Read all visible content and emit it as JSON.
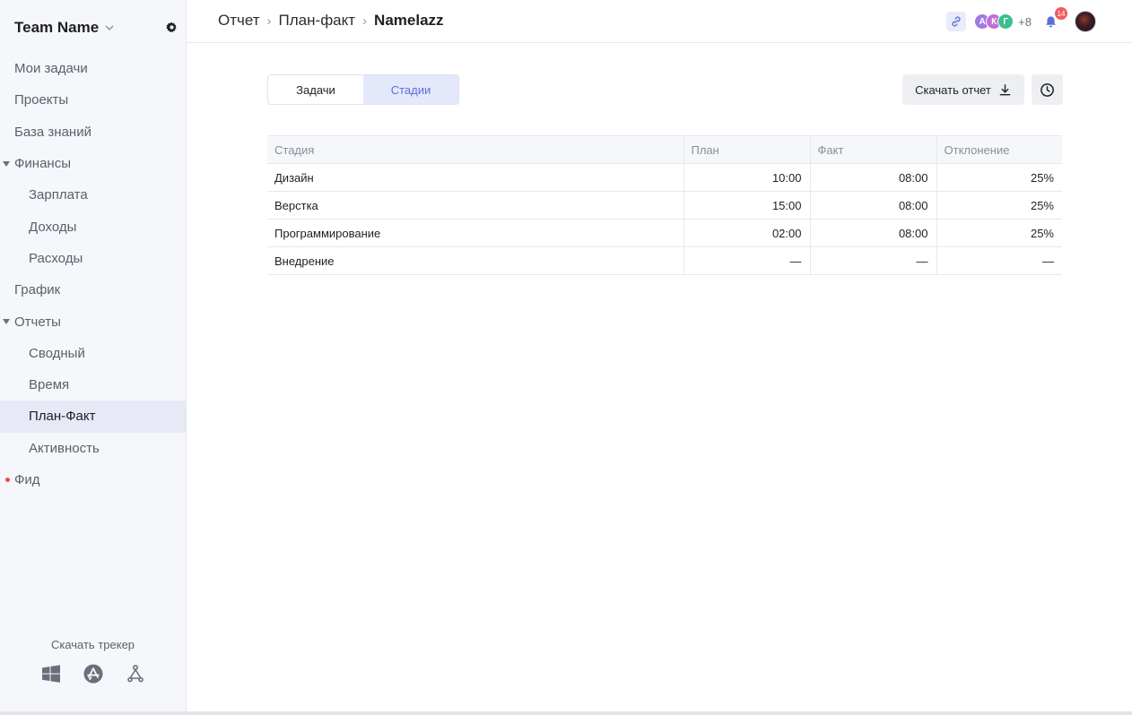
{
  "team": {
    "name": "Team Name"
  },
  "nav": {
    "my_tasks": "Мои задачи",
    "projects": "Проекты",
    "knowledge": "База знаний",
    "finance": "Финансы",
    "salary": "Зарплата",
    "income": "Доходы",
    "expenses": "Расходы",
    "schedule": "График",
    "reports": "Отчеты",
    "summary": "Сводный",
    "time": "Время",
    "plan_fact": "План-Факт",
    "activity": "Активность",
    "feed": "Фид"
  },
  "tracker": {
    "label": "Скачать трекер",
    "icons": [
      "windows-icon",
      "app-store-icon",
      "linux-icon"
    ]
  },
  "breadcrumbs": {
    "root": "Отчет",
    "section": "План-факт",
    "current": "Namelazz"
  },
  "header": {
    "avatars": [
      {
        "initial": "А",
        "color": "#a07be0"
      },
      {
        "initial": "К",
        "color": "#c06fd8"
      },
      {
        "initial": "Г",
        "color": "#3bbf8f"
      }
    ],
    "more_count": "+8",
    "notifications": "14"
  },
  "tabs": {
    "tasks": "Задачи",
    "stages": "Стадии",
    "active": "Стадии"
  },
  "actions": {
    "download": "Скачать отчет"
  },
  "table": {
    "headers": {
      "stage": "Стадия",
      "plan": "План",
      "fact": "Факт",
      "deviation": "Отклонение"
    },
    "rows": [
      {
        "stage": "Дизайн",
        "plan": "10:00",
        "fact": "08:00",
        "deviation": "25%"
      },
      {
        "stage": "Верстка",
        "plan": "15:00",
        "fact": "08:00",
        "deviation": "25%"
      },
      {
        "stage": "Программирование",
        "plan": "02:00",
        "fact": "08:00",
        "deviation": "25%"
      },
      {
        "stage": "Внедрение",
        "plan": "—",
        "fact": "—",
        "deviation": "—"
      }
    ]
  },
  "colors": {
    "accent": "#5a6fd6",
    "active_bg": "#e7e9f6",
    "badge": "#f25b5b"
  }
}
